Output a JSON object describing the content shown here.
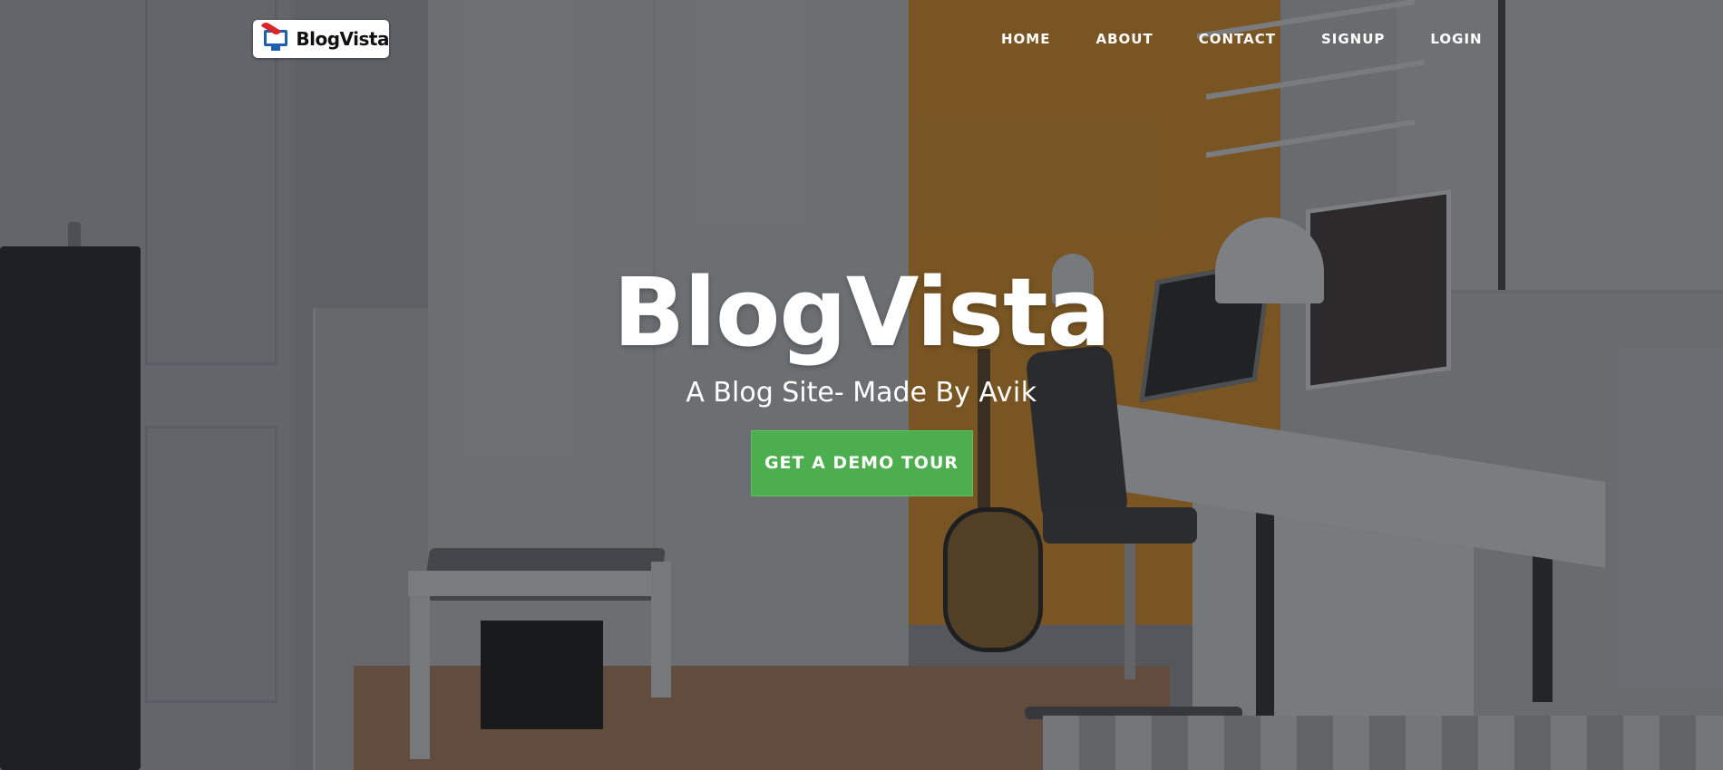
{
  "brand": {
    "logo_text": "BlogVista",
    "logo_icon": "monitor-with-feather-icon"
  },
  "nav": {
    "items": [
      {
        "label": "HOME"
      },
      {
        "label": "ABOUT"
      },
      {
        "label": "CONTACT"
      },
      {
        "label": "SIGNUP"
      },
      {
        "label": "LOGIN"
      }
    ]
  },
  "hero": {
    "title": "BlogVista",
    "subtitle_prefix": "A Blog Site- Made By ",
    "subtitle_author": "Avik",
    "cta_label": "GET A DEMO TOUR",
    "background_description": "darkened photo of a home office room"
  },
  "colors": {
    "cta_background": "#4cae4f",
    "nav_text": "#ffffff",
    "logo_blue": "#1f5fb0",
    "logo_red": "#d8262b"
  }
}
